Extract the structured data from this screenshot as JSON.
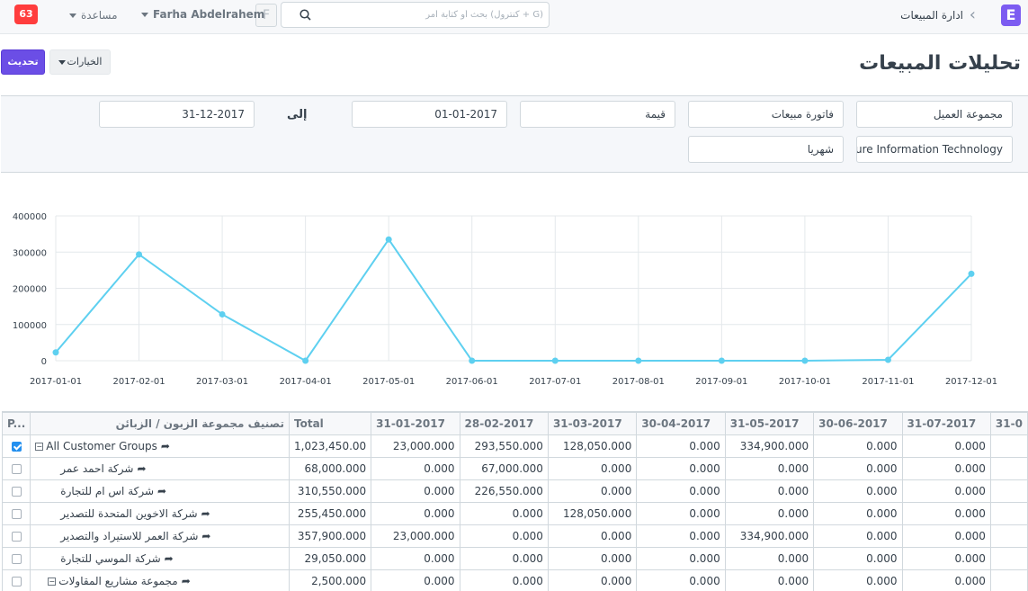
{
  "navbar": {
    "logo": "E",
    "breadcrumb": "ادارة المبيعات",
    "search_placeholder": "بحث أو كتابة أمر (كنترول + G)",
    "avatar_letter": "F",
    "user_name": "Farha Abdelrahem",
    "help": "مساعدة",
    "notifications": "63"
  },
  "page": {
    "title": "تحليلات المبيعات",
    "refresh_label": "تحديث",
    "options_label": "الخيارات"
  },
  "filters": {
    "tree_type": "مجموعة العميل",
    "doc_type": "فاتورة مبيعات",
    "value_quantity": "قيمة",
    "from_date": "01-01-2017",
    "to_label": "إلى",
    "to_date": "31-12-2017",
    "company": "Future Information Technology",
    "range": "شهريا"
  },
  "chart_data": {
    "type": "line",
    "x": [
      "2017-01-01",
      "2017-02-01",
      "2017-03-01",
      "2017-04-01",
      "2017-05-01",
      "2017-06-01",
      "2017-07-01",
      "2017-08-01",
      "2017-09-01",
      "2017-10-01",
      "2017-11-01",
      "2017-12-01"
    ],
    "series": [
      {
        "values": [
          23000,
          293550,
          128050,
          0,
          334900,
          0,
          0,
          0,
          0,
          0,
          2500,
          240000
        ]
      }
    ],
    "y_ticks": [
      "0",
      "100000",
      "200000",
      "300000",
      "400000"
    ],
    "ylim": [
      0,
      400000
    ],
    "grid": true,
    "color": "#5ed0f0"
  },
  "table": {
    "columns": [
      "P...",
      "تصنيف مجموعة الزبون / الزبائن",
      "Total",
      "31-01-2017",
      "28-02-2017",
      "31-03-2017",
      "30-04-2017",
      "31-05-2017",
      "30-06-2017",
      "31-07-2017",
      "31-0"
    ],
    "rows": [
      {
        "checked": true,
        "name": "All Customer Groups",
        "toggle": "−",
        "cells": [
          "1,023,450.00",
          "23,000.000",
          "293,550.000",
          "128,050.000",
          "0.000",
          "334,900.000",
          "0.000",
          "0.000"
        ]
      },
      {
        "checked": false,
        "name": "شركة احمد عمر",
        "cells": [
          "68,000.000",
          "0.000",
          "67,000.000",
          "0.000",
          "0.000",
          "0.000",
          "0.000",
          "0.000"
        ]
      },
      {
        "checked": false,
        "name": "شركة اس ام للتجارة",
        "cells": [
          "310,550.000",
          "0.000",
          "226,550.000",
          "0.000",
          "0.000",
          "0.000",
          "0.000",
          "0.000"
        ]
      },
      {
        "checked": false,
        "name": "شركة الاخوين المتحدة للتصدير",
        "cells": [
          "255,450.000",
          "0.000",
          "0.000",
          "128,050.000",
          "0.000",
          "0.000",
          "0.000",
          "0.000"
        ]
      },
      {
        "checked": false,
        "name": "شركة العمر للاستيراد والتصدير",
        "cells": [
          "357,900.000",
          "23,000.000",
          "0.000",
          "0.000",
          "0.000",
          "334,900.000",
          "0.000",
          "0.000"
        ]
      },
      {
        "checked": false,
        "name": "شركة الموسي للتجارة",
        "cells": [
          "29,050.000",
          "0.000",
          "0.000",
          "0.000",
          "0.000",
          "0.000",
          "0.000",
          "0.000"
        ]
      },
      {
        "checked": false,
        "name": "مجموعة مشاريع المقاولات",
        "toggle": "−",
        "cells": [
          "2,500.000",
          "0.000",
          "0.000",
          "0.000",
          "0.000",
          "0.000",
          "0.000",
          "0.000"
        ]
      }
    ]
  }
}
